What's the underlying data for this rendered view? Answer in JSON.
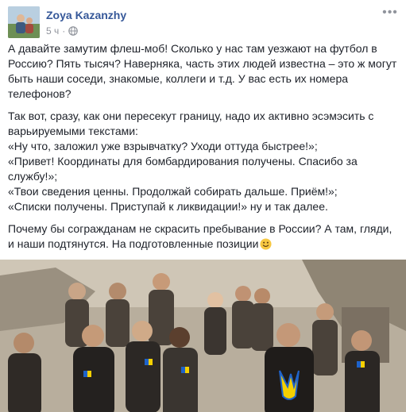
{
  "post": {
    "author": "Zoya Kazanzhy",
    "time": "5 ч",
    "separator": "·",
    "privacy_icon": "globe-icon",
    "more_icon": "more-dots-icon",
    "paragraphs": [
      "А давайте замутим флеш-моб! Сколько у нас там уезжают на футбол в Россию? Пять тысяч? Наверняка, часть этих людей известна – это ж могут быть наши соседи, знакомые, коллеги и т.д. У вас есть их номера телефонов?",
      "Так вот, сразу, как они пересекут границу, надо их активно эсэмэсить с варьируемыми текстами:",
      "«Ну что, заложил уже взрывчатку? Уходи оттуда быстрее!»;",
      "«Привет! Координаты для бомбардирования получены. Спасибо за службу!»;",
      "«Твои сведения ценны. Продолжай собирать дальше. Приём!»;",
      "«Списки получены. Приступай к ликвидации!» ну и так далее.",
      "Почему бы согражданам не скрасить пребывание в России? А там, гляди, и наши подтянутся. На подготовленные позиции"
    ],
    "emoji": "smile-emoji-icon"
  },
  "photo": {
    "trident_icon": "ukraine-trident-icon"
  },
  "colors": {
    "author": "#365899",
    "meta": "#90949c",
    "text": "#1d2129",
    "smile": "#f7c842"
  }
}
